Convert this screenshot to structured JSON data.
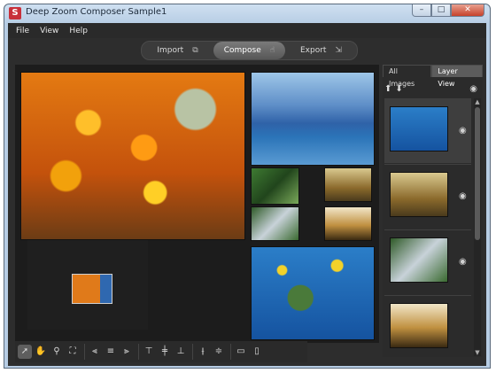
{
  "window": {
    "title": "Deep Zoom Composer Sample1",
    "app_icon": "S",
    "controls": {
      "minimize": "–",
      "maximize": "□",
      "close": "✕"
    }
  },
  "menu": {
    "items": [
      "File",
      "View",
      "Help"
    ]
  },
  "modes": [
    {
      "label": "Import",
      "icon": "import-icon",
      "active": false
    },
    {
      "label": "Compose",
      "icon": "hand-icon",
      "active": true
    },
    {
      "label": "Export",
      "icon": "export-icon",
      "active": false
    }
  ],
  "side_panel": {
    "tabs": [
      "All Images",
      "Layer View"
    ],
    "active_tab": "Layer View",
    "layers": [
      {
        "image": "sea-turtle",
        "selected": true
      },
      {
        "image": "tree-sunset",
        "selected": false
      },
      {
        "image": "waterfall",
        "selected": false
      },
      {
        "image": "tree-dawn",
        "selected": false
      }
    ]
  },
  "canvas": {
    "images": [
      "sunflowers",
      "ocean-dock",
      "forest",
      "tree",
      "waterfall",
      "tree-dawn",
      "sea-turtle"
    ]
  },
  "toolbar": {
    "groups": [
      [
        "select-icon",
        "pan-hand-icon",
        "zoom-icon",
        "fit-icon"
      ],
      [
        "align-left-icon",
        "align-center-icon",
        "align-right-icon"
      ],
      [
        "align-top-icon",
        "align-middle-icon",
        "align-bottom-icon"
      ],
      [
        "distribute-h-icon",
        "distribute-v-icon"
      ],
      [
        "same-width-icon",
        "same-height-icon"
      ]
    ]
  }
}
